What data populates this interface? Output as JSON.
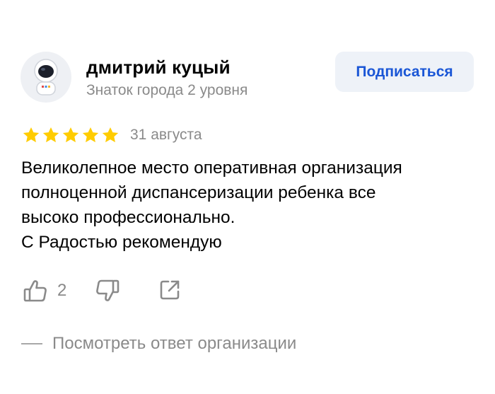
{
  "author": {
    "name": "дмитрий куцый",
    "level": "Знаток города 2 уровня",
    "avatar_icon": "astronaut-avatar-icon"
  },
  "subscribe": {
    "label": "Подписаться",
    "color": "#1a56d6"
  },
  "review": {
    "rating": 5,
    "rating_max": 5,
    "star_color": "#ffcc00",
    "date": "31 августа",
    "text_lines": [
      "Великолепное место оперативная организация",
      "полноценной диспансеризации ребенка все",
      "высоко профессионально.",
      "С Радостью рекомендую"
    ]
  },
  "actions": {
    "like_icon": "thumbs-up-icon",
    "like_count": "2",
    "dislike_icon": "thumbs-down-icon",
    "share_icon": "share-icon"
  },
  "reply": {
    "label": "Посмотреть ответ организации"
  }
}
